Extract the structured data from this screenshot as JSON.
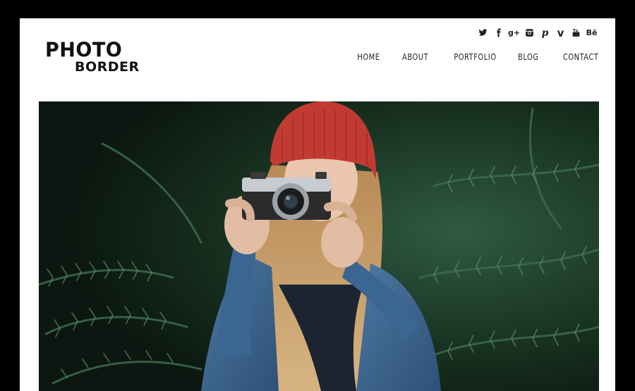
{
  "logo": {
    "line1": "PHOTO",
    "line2": "BORDER"
  },
  "social": [
    {
      "icon": "twitter-icon"
    },
    {
      "icon": "facebook-icon"
    },
    {
      "icon": "google-plus-icon",
      "glyph": "g+"
    },
    {
      "icon": "instagram-icon"
    },
    {
      "icon": "pinterest-icon",
      "glyph": "p"
    },
    {
      "icon": "vimeo-icon",
      "glyph": "v"
    },
    {
      "icon": "youtube-icon"
    },
    {
      "icon": "behance-icon",
      "glyph": "Bē"
    }
  ],
  "nav": {
    "home": "HOME",
    "about": "ABOUT",
    "portfolio": "PORTFOLIO",
    "blog": "BLOG",
    "contact": "CONTACT"
  },
  "hero": {
    "description_colors": {
      "foliage": "#1e3a2a",
      "hat": "#c43a33",
      "jacket": "#3f6790",
      "hair": "#c9a06a",
      "skin": "#e6c2a8"
    }
  }
}
